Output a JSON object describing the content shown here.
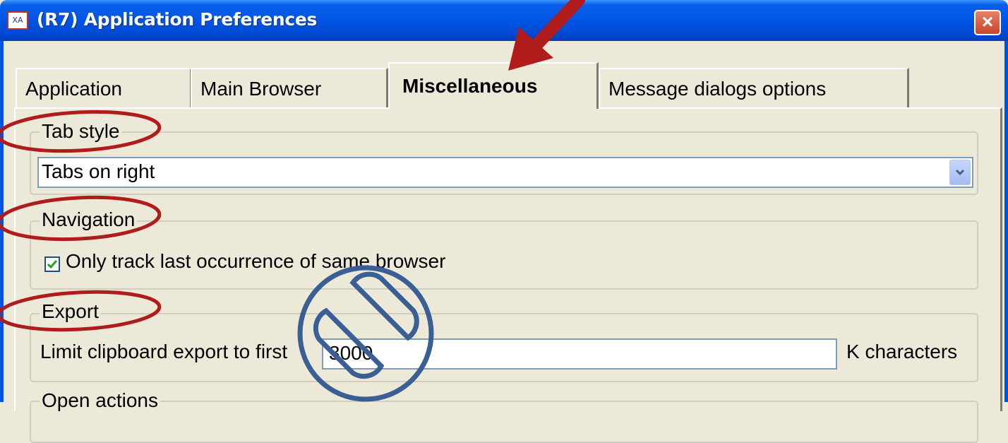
{
  "window": {
    "title": "(R7) Application Preferences",
    "icon": "app-icon",
    "icon_text": "XA",
    "close_glyph": "×",
    "colors": {
      "titlebar": "#0054e3",
      "face": "#ece9d8",
      "annotation_red": "#b01c1c",
      "annotation_blue": "#3a5f95"
    }
  },
  "tabs": [
    {
      "label": "Application",
      "selected": false
    },
    {
      "label": "Main Browser",
      "selected": false
    },
    {
      "label": "Miscellaneous",
      "selected": true
    },
    {
      "label": "Message dialogs options",
      "selected": false
    }
  ],
  "groups": {
    "tab_style": {
      "legend": "Tab style",
      "select_value": "Tabs on right"
    },
    "navigation": {
      "legend": "Navigation",
      "checkbox_label": "Only track last occurrence of same browser",
      "checked": true
    },
    "export": {
      "legend": "Export",
      "label": "Limit clipboard export to first",
      "value": "3000",
      "unit": "K characters"
    },
    "open_actions": {
      "legend": "Open actions"
    }
  }
}
